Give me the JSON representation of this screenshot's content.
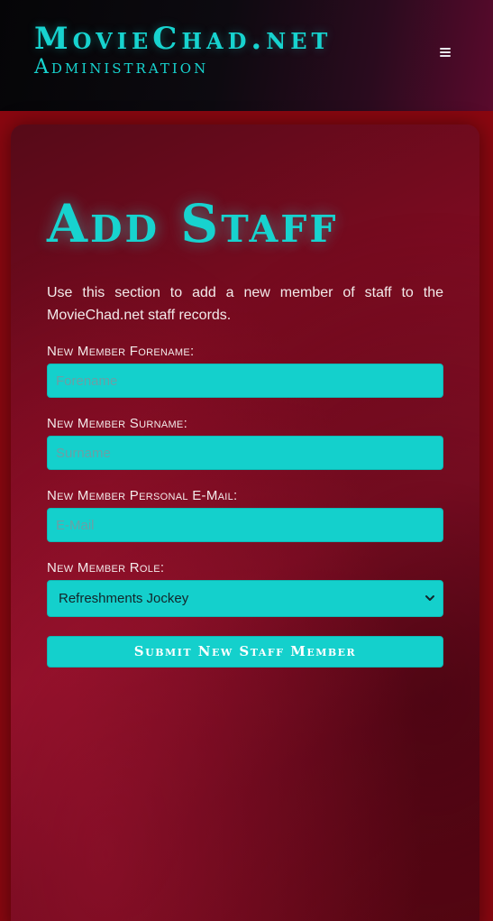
{
  "header": {
    "title": "MovieChad.net",
    "subtitle": "Administration"
  },
  "main": {
    "heading": "Add Staff",
    "intro": "Use this section to add a new member of staff to the MovieChad.net staff records.",
    "form": {
      "forename": {
        "label": "New Member Forename:",
        "placeholder": "Forename",
        "value": ""
      },
      "surname": {
        "label": "New Member Surname:",
        "placeholder": "Surname",
        "value": ""
      },
      "email": {
        "label": "New Member Personal E-Mail:",
        "placeholder": "E-Mail",
        "value": ""
      },
      "role": {
        "label": "New Member Role:",
        "selected": "Refreshments Jockey"
      },
      "submit_label": "Submit New Staff Member"
    }
  },
  "colors": {
    "accent": "#17d3cf",
    "page_background": "#8a0710",
    "header_background": "#0d0a10"
  },
  "icons": {
    "menu": "hamburger-menu-icon",
    "select_arrow": "chevron-down-icon"
  }
}
